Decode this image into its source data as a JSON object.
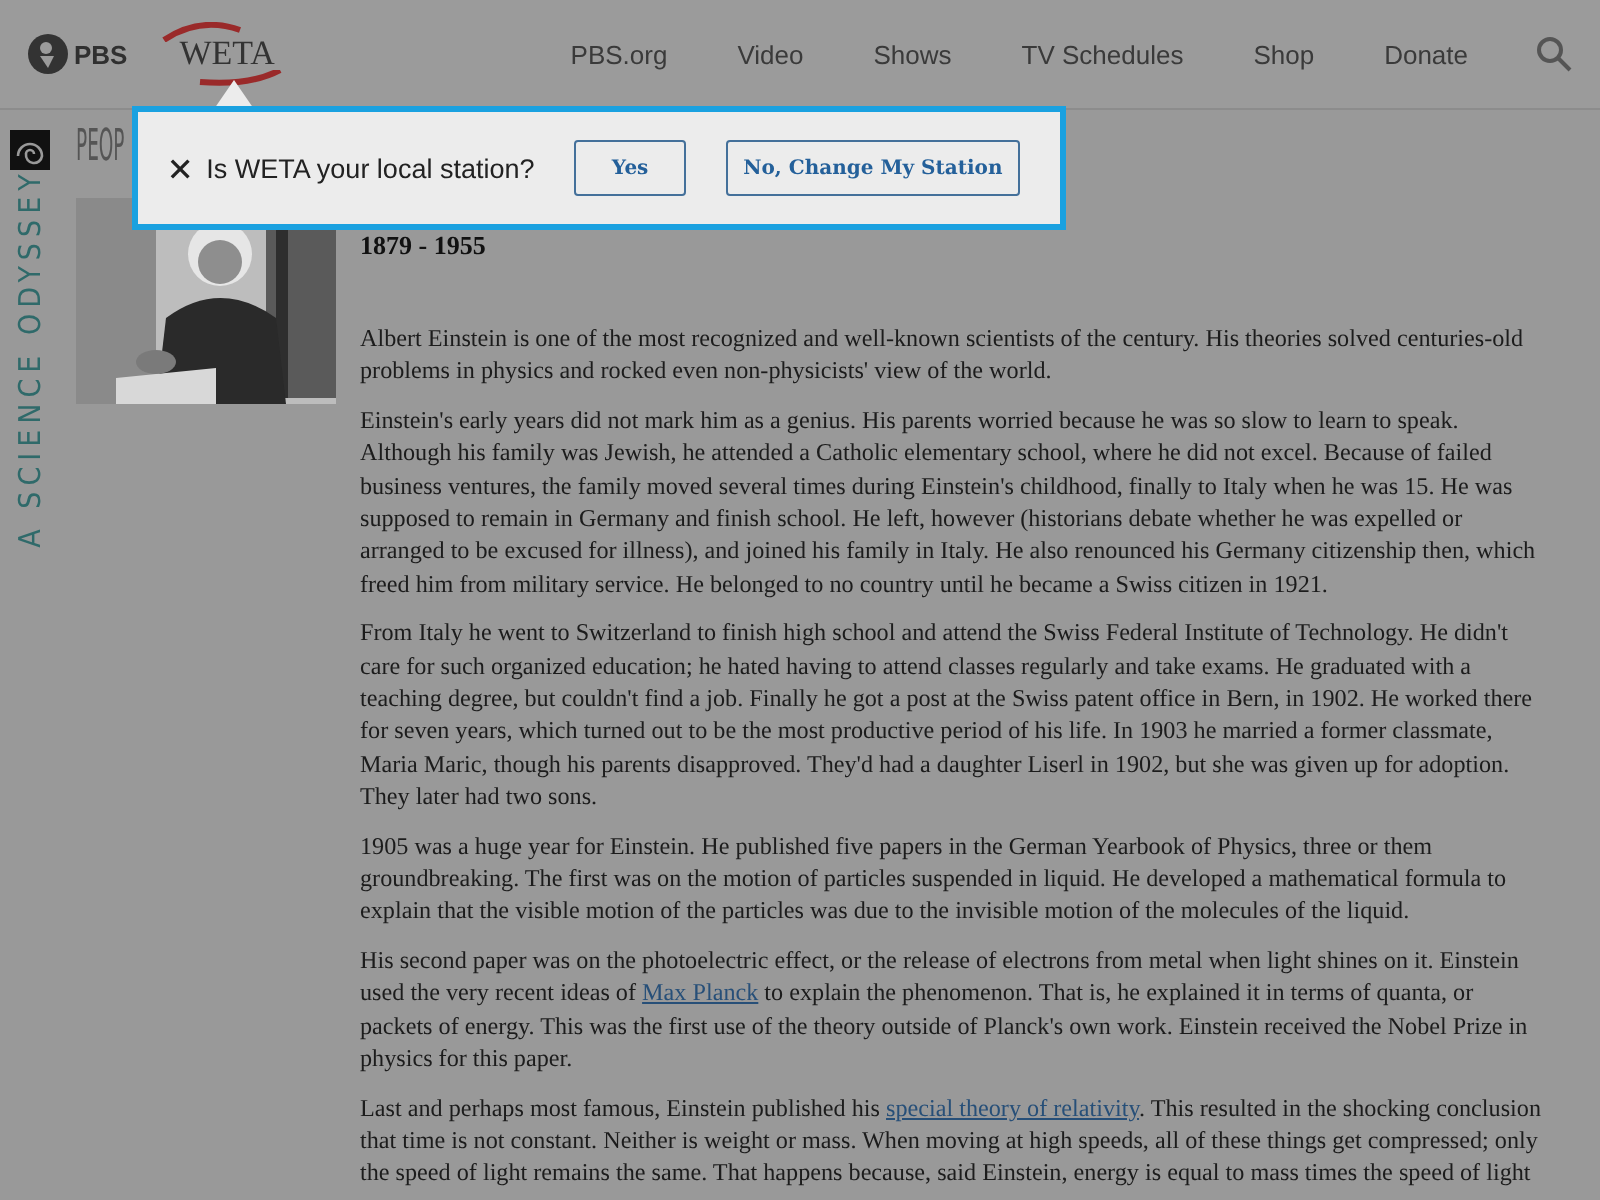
{
  "header": {
    "pbs_label": "PBS",
    "station_label": "WETA",
    "nav": [
      "PBS.org",
      "Video",
      "Shows",
      "TV Schedules",
      "Shop",
      "Donate"
    ]
  },
  "popup": {
    "question": "Is WETA your local station?",
    "buttons": [
      "Yes",
      "No, Change My Station"
    ]
  },
  "side_title": "A SCIENCE ODYSSEY",
  "section_heading": "PEOP",
  "dates": "1879 - 1955",
  "paragraphs": [
    {
      "lines": [
        "Albert Einstein is one of the most recognized and well-known scientists of the century. His theories solved centuries-old",
        "problems in physics and rocked even non-physicists' view of the world."
      ]
    },
    {
      "lines": [
        "Einstein's early years did not mark him as a genius. His parents worried because he was so slow to learn to speak.",
        "Although his family was Jewish, he attended a Catholic elementary school, where he did not excel. Because of failed",
        "business ventures, the family moved several times during Einstein's childhood, finally to Italy when he was 15. He was",
        "supposed to remain in Germany and finish school. He left, however (historians debate whether he was expelled or",
        "arranged to be excused for illness), and joined his family in Italy. He also renounced his Germany citizenship then, which",
        "freed him from military service. He belonged to no country until he became a Swiss citizen in 1921."
      ]
    },
    {
      "lines": [
        "From Italy he went to Switzerland to finish high school and attend the Swiss Federal Institute of Technology. He didn't",
        "care for such organized education; he hated having to attend classes regularly and take exams. He graduated with a",
        "teaching degree, but couldn't find a job. Finally he got a post at the Swiss patent office in Bern, in 1902. He worked there",
        "for seven years, which turned out to be the most productive period of his life. In 1903 he married a former classmate,",
        "Maria Maric, though his parents disapproved. They'd had a daughter Liserl in 1902, but she was given up for adoption.",
        "They later had two sons."
      ]
    },
    {
      "lines": [
        "1905 was a huge year for Einstein. He published five papers in the German Yearbook of Physics, three or them",
        "groundbreaking. The first was on the motion of particles suspended in liquid. He developed a mathematical formula to",
        "explain that the visible motion of the particles was due to the invisible motion of the molecules of the liquid."
      ]
    },
    {
      "lines": [
        "His second paper was on the photoelectric effect, or the release of electrons from metal when light shines on it. Einstein",
        {
          "before": "used the very recent ideas of ",
          "link": "Max Planck",
          "after": " to explain the phenomenon. That is, he explained it in terms of quanta, or"
        },
        "packets of energy. This was the first use of the theory outside of Planck's own work. Einstein received the Nobel Prize in",
        "physics for this paper."
      ]
    },
    {
      "lines": [
        {
          "before": "Last and perhaps most famous, Einstein published his ",
          "link": "special theory of relativity",
          "after": ". This resulted in the shocking conclusion"
        },
        "that time is not constant. Neither is weight or mass. When moving at high speeds, all of these things get compressed; only",
        "the speed of light remains the same. That happens because, said Einstein, energy is equal to mass times the speed of light"
      ]
    }
  ]
}
